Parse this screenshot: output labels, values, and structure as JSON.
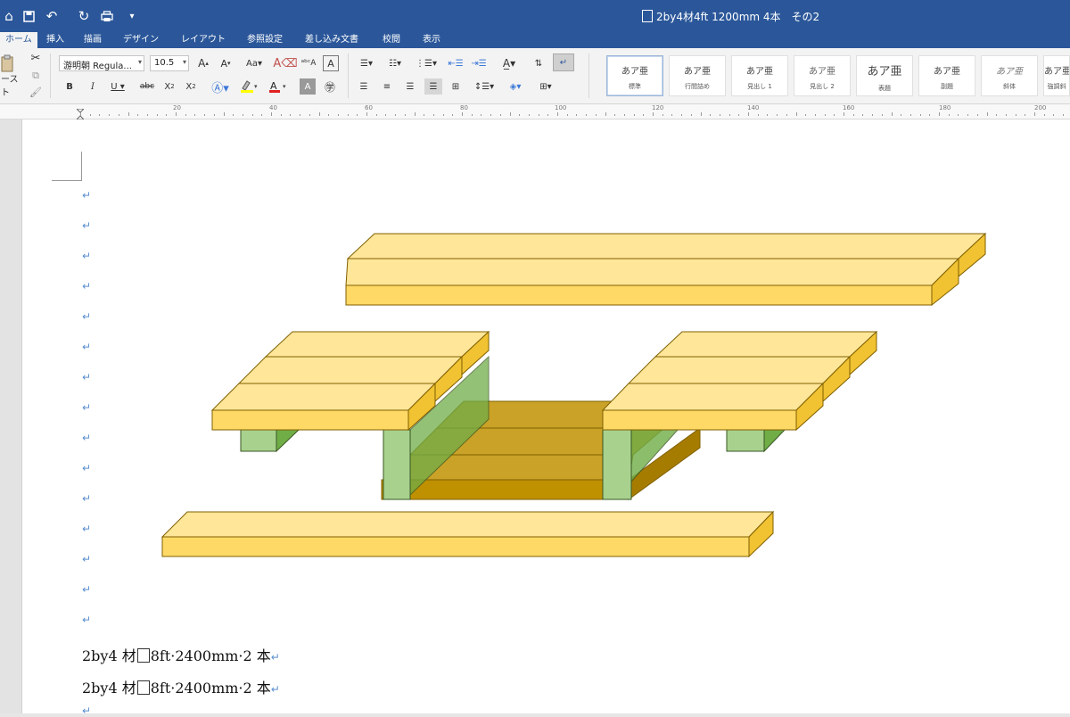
{
  "title_bar": {
    "document_title": "2by4材4ft 1200mm 4本　その2"
  },
  "quick_access": [
    "home-icon",
    "save-icon",
    "undo-icon",
    "redo-icon",
    "print-icon",
    "customize-icon"
  ],
  "tabs": [
    {
      "label": "ホーム",
      "active": true
    },
    {
      "label": "挿入"
    },
    {
      "label": "描画"
    },
    {
      "label": "デザイン"
    },
    {
      "label": "レイアウト"
    },
    {
      "label": "参照設定"
    },
    {
      "label": "差し込み文書"
    },
    {
      "label": "校閲"
    },
    {
      "label": "表示"
    }
  ],
  "clipboard": {
    "paste_label": "ースト"
  },
  "font": {
    "name": "游明朝 Regula...",
    "size": "10.5"
  },
  "styles": [
    {
      "sample": "あア亜",
      "name": "標準"
    },
    {
      "sample": "あア亜",
      "name": "行間詰め"
    },
    {
      "sample": "あア亜",
      "name": "見出し 1"
    },
    {
      "sample": "あア亜",
      "name": "見出し 2"
    },
    {
      "sample": "あア亜",
      "name": "表題"
    },
    {
      "sample": "あア亜",
      "name": "副題"
    },
    {
      "sample": "あア亜",
      "name": "斜体"
    },
    {
      "sample": "あア亜",
      "name": "強調斜"
    }
  ],
  "ruler": {
    "numbers": [
      "20",
      "40",
      "60",
      "80",
      "100",
      "120",
      "140",
      "160",
      "180",
      "200"
    ]
  },
  "body": {
    "line1": {
      "before": "2by4 材",
      "after": "8ft·2400mm·2 本"
    },
    "line2": {
      "before": "2by4 材",
      "after": "8ft·2400mm·2 本"
    }
  },
  "colors": {
    "titlebar": "#2b579a",
    "board_light": "#ffd966",
    "board_top": "#ffe699",
    "board_side": "#f1c232",
    "spacer_green": "#a9d18e",
    "base_brown": "#bf9000"
  }
}
